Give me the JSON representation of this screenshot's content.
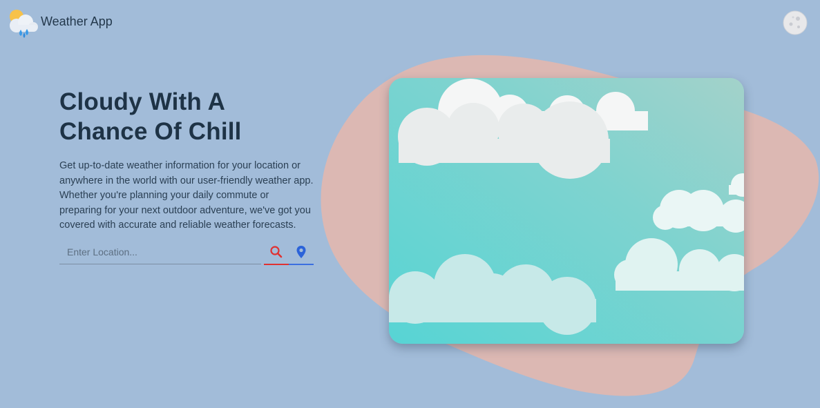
{
  "header": {
    "app_title": "Weather App",
    "logo_icon": "cloud-sun-rain-icon",
    "theme_toggle_icon": "moon-icon"
  },
  "hero": {
    "title": "Cloudy With A Chance Of Chill",
    "description": "Get up-to-date weather information for your location or anywhere in the world with our user-friendly weather app. Whether you're planning your daily commute or preparing for your next outdoor adventure, we've got you covered with accurate and reliable weather forecasts."
  },
  "search": {
    "value": "",
    "placeholder": "Enter Location...",
    "search_icon": "search-icon",
    "locate_icon": "location-pin-icon"
  },
  "illustration": {
    "icon": "cloudy-sky-illustration"
  },
  "colors": {
    "background": "#a2bcd9",
    "blob": "#dcb8b3",
    "sky_start": "#57d4d4",
    "sky_end": "#9fd3cc",
    "search_accent": "#e03131",
    "locate_accent": "#3b6fe0"
  }
}
